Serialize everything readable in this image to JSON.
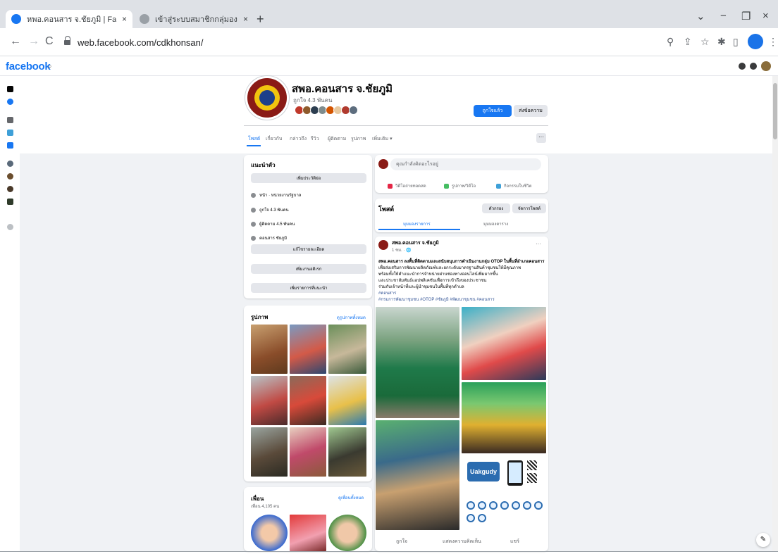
{
  "browser": {
    "tabs": [
      {
        "title": "หพอ.คอนสาร จ.ชัยภูมิ | Facebook"
      },
      {
        "title": "เข้าสู่ระบบสมาชิกกลุ่มองค์กรสตรี"
      }
    ],
    "tab_close": "×",
    "new_tab": "+",
    "url": "web.facebook.com/cdkhonsan/",
    "back": "←",
    "forward": "→",
    "reload": "C",
    "minimize": "−",
    "restore": "❐",
    "close": "×",
    "chevron": "⌄"
  },
  "facebook": {
    "logo": "facebook",
    "search_glyph": "⌕"
  },
  "page": {
    "name": "สพอ.คอนสาร จ.ชัยภูมิ",
    "likes": "ถูกใจ 4.3 พันคน",
    "primary_button": "ถูกใจแล้ว",
    "secondary_button": "ส่งข้อความ",
    "tabs": [
      "โพสต์",
      "เกี่ยวกับ",
      "กล่าวถึง",
      "รีวิว",
      "ผู้ติดตาม",
      "รูปภาพ",
      "วิดีโอ",
      "เพิ่มเติม ▾"
    ],
    "more_glyph": "···"
  },
  "intro": {
    "title": "แนะนำตัว",
    "edit_button": "เพิ่มประวัติย่อ",
    "rows": [
      "หน้า · หน่วยงานรัฐบาล",
      "ถูกใจ 4.3 พันคน",
      "ผู้ติดตาม 4.5 พันคน",
      "คอนสาร ชัยภูมิ"
    ],
    "buttons": [
      "แก้ไขรายละเอียด",
      "เพิ่มงานอดิเรก",
      "เพิ่มรายการที่แนะนำ"
    ]
  },
  "photos": {
    "title": "รูปภาพ",
    "link": "ดูรูปภาพทั้งหมด"
  },
  "friends": {
    "title": "เพื่อน",
    "subtitle": "เพื่อน 4,105 คน",
    "link": "ดูเพื่อนทั้งหมด"
  },
  "composer": {
    "placeholder": "คุณกำลังคิดอะไรอยู่",
    "actions": [
      "วิดีโอถ่ายทอดสด",
      "รูปภาพ/วิดีโอ",
      "กิจกรรมในชีวิต"
    ]
  },
  "posts": {
    "title": "โพสต์",
    "filter_button": "ตัวกรอง",
    "manage_button": "จัดการโพสต์",
    "view_list": "มุมมองรายการ",
    "view_grid": "มุมมองตาราง",
    "post": {
      "author": "สพอ.คอนสาร จ.ชัยภูมิ",
      "time": "1 ชม. · 🌐",
      "more": "···",
      "lines": [
        "สพอ.คอนสาร ลงพื้นที่ติดตามและสนับสนุนการดำเนินงานกลุ่ม OTOP ในพื้นที่อำเภอคอนสาร",
        "เพื่อส่งเสริมการพัฒนาผลิตภัณฑ์และยกระดับมาตรฐานสินค้าชุมชนให้มีคุณภาพ",
        "พร้อมทั้งให้คำแนะนำการจำหน่ายผ่านช่องทางออนไลน์เพิ่มมากขึ้น",
        "และประชาสัมพันธ์แอปพลิเคชันเพื่อการเข้าถึงของประชาชน",
        "ร่วมกับเจ้าหน้าที่และผู้นำชุมชนในพื้นที่ทุกตำบล",
        "#คอนสาร",
        "#กรมการพัฒนาชุมชน #OTOP #ชัยภูมิ #พัฒนาชุมชน #คอนสาร"
      ],
      "app_name": "Uakgudy",
      "actions": [
        "ถูกใจ",
        "แสดงความคิดเห็น",
        "แชร์"
      ]
    }
  },
  "colors": {
    "facebook_blue": "#1877f2",
    "page_bg": "#f0f2f5",
    "card_bg": "#ffffff"
  }
}
